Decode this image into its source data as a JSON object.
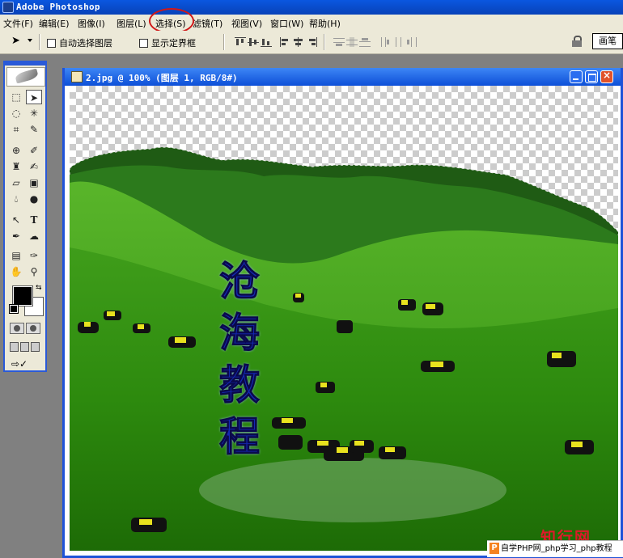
{
  "app": {
    "title": "Adobe Photoshop"
  },
  "menu": {
    "items": [
      "文件(F)",
      "编辑(E)",
      "图像(I)",
      "图层(L)",
      "选择(S)",
      "滤镜(T)",
      "视图(V)",
      "窗口(W)",
      "帮助(H)"
    ],
    "highlighted": "选择(S)"
  },
  "options": {
    "auto_select_label": "自动选择图层",
    "show_bounds_label": "显示定界框",
    "palette_tab_label": "画笔"
  },
  "document": {
    "title": "2.jpg @ 100% (图层 1, RGB/8#)"
  },
  "canvas_text": {
    "chars": [
      "沧",
      "海",
      "教",
      "程"
    ]
  },
  "watermark": {
    "logo": "知行网",
    "badge": "自学PHP网_php学习_php教程"
  },
  "colors": {
    "titlebar": "#0842b8",
    "document_frame": "#1f53d8",
    "foreground": "#000000",
    "background": "#ffffff",
    "text_blue": "#1428b4",
    "menu_highlight_ring": "#d01818"
  }
}
